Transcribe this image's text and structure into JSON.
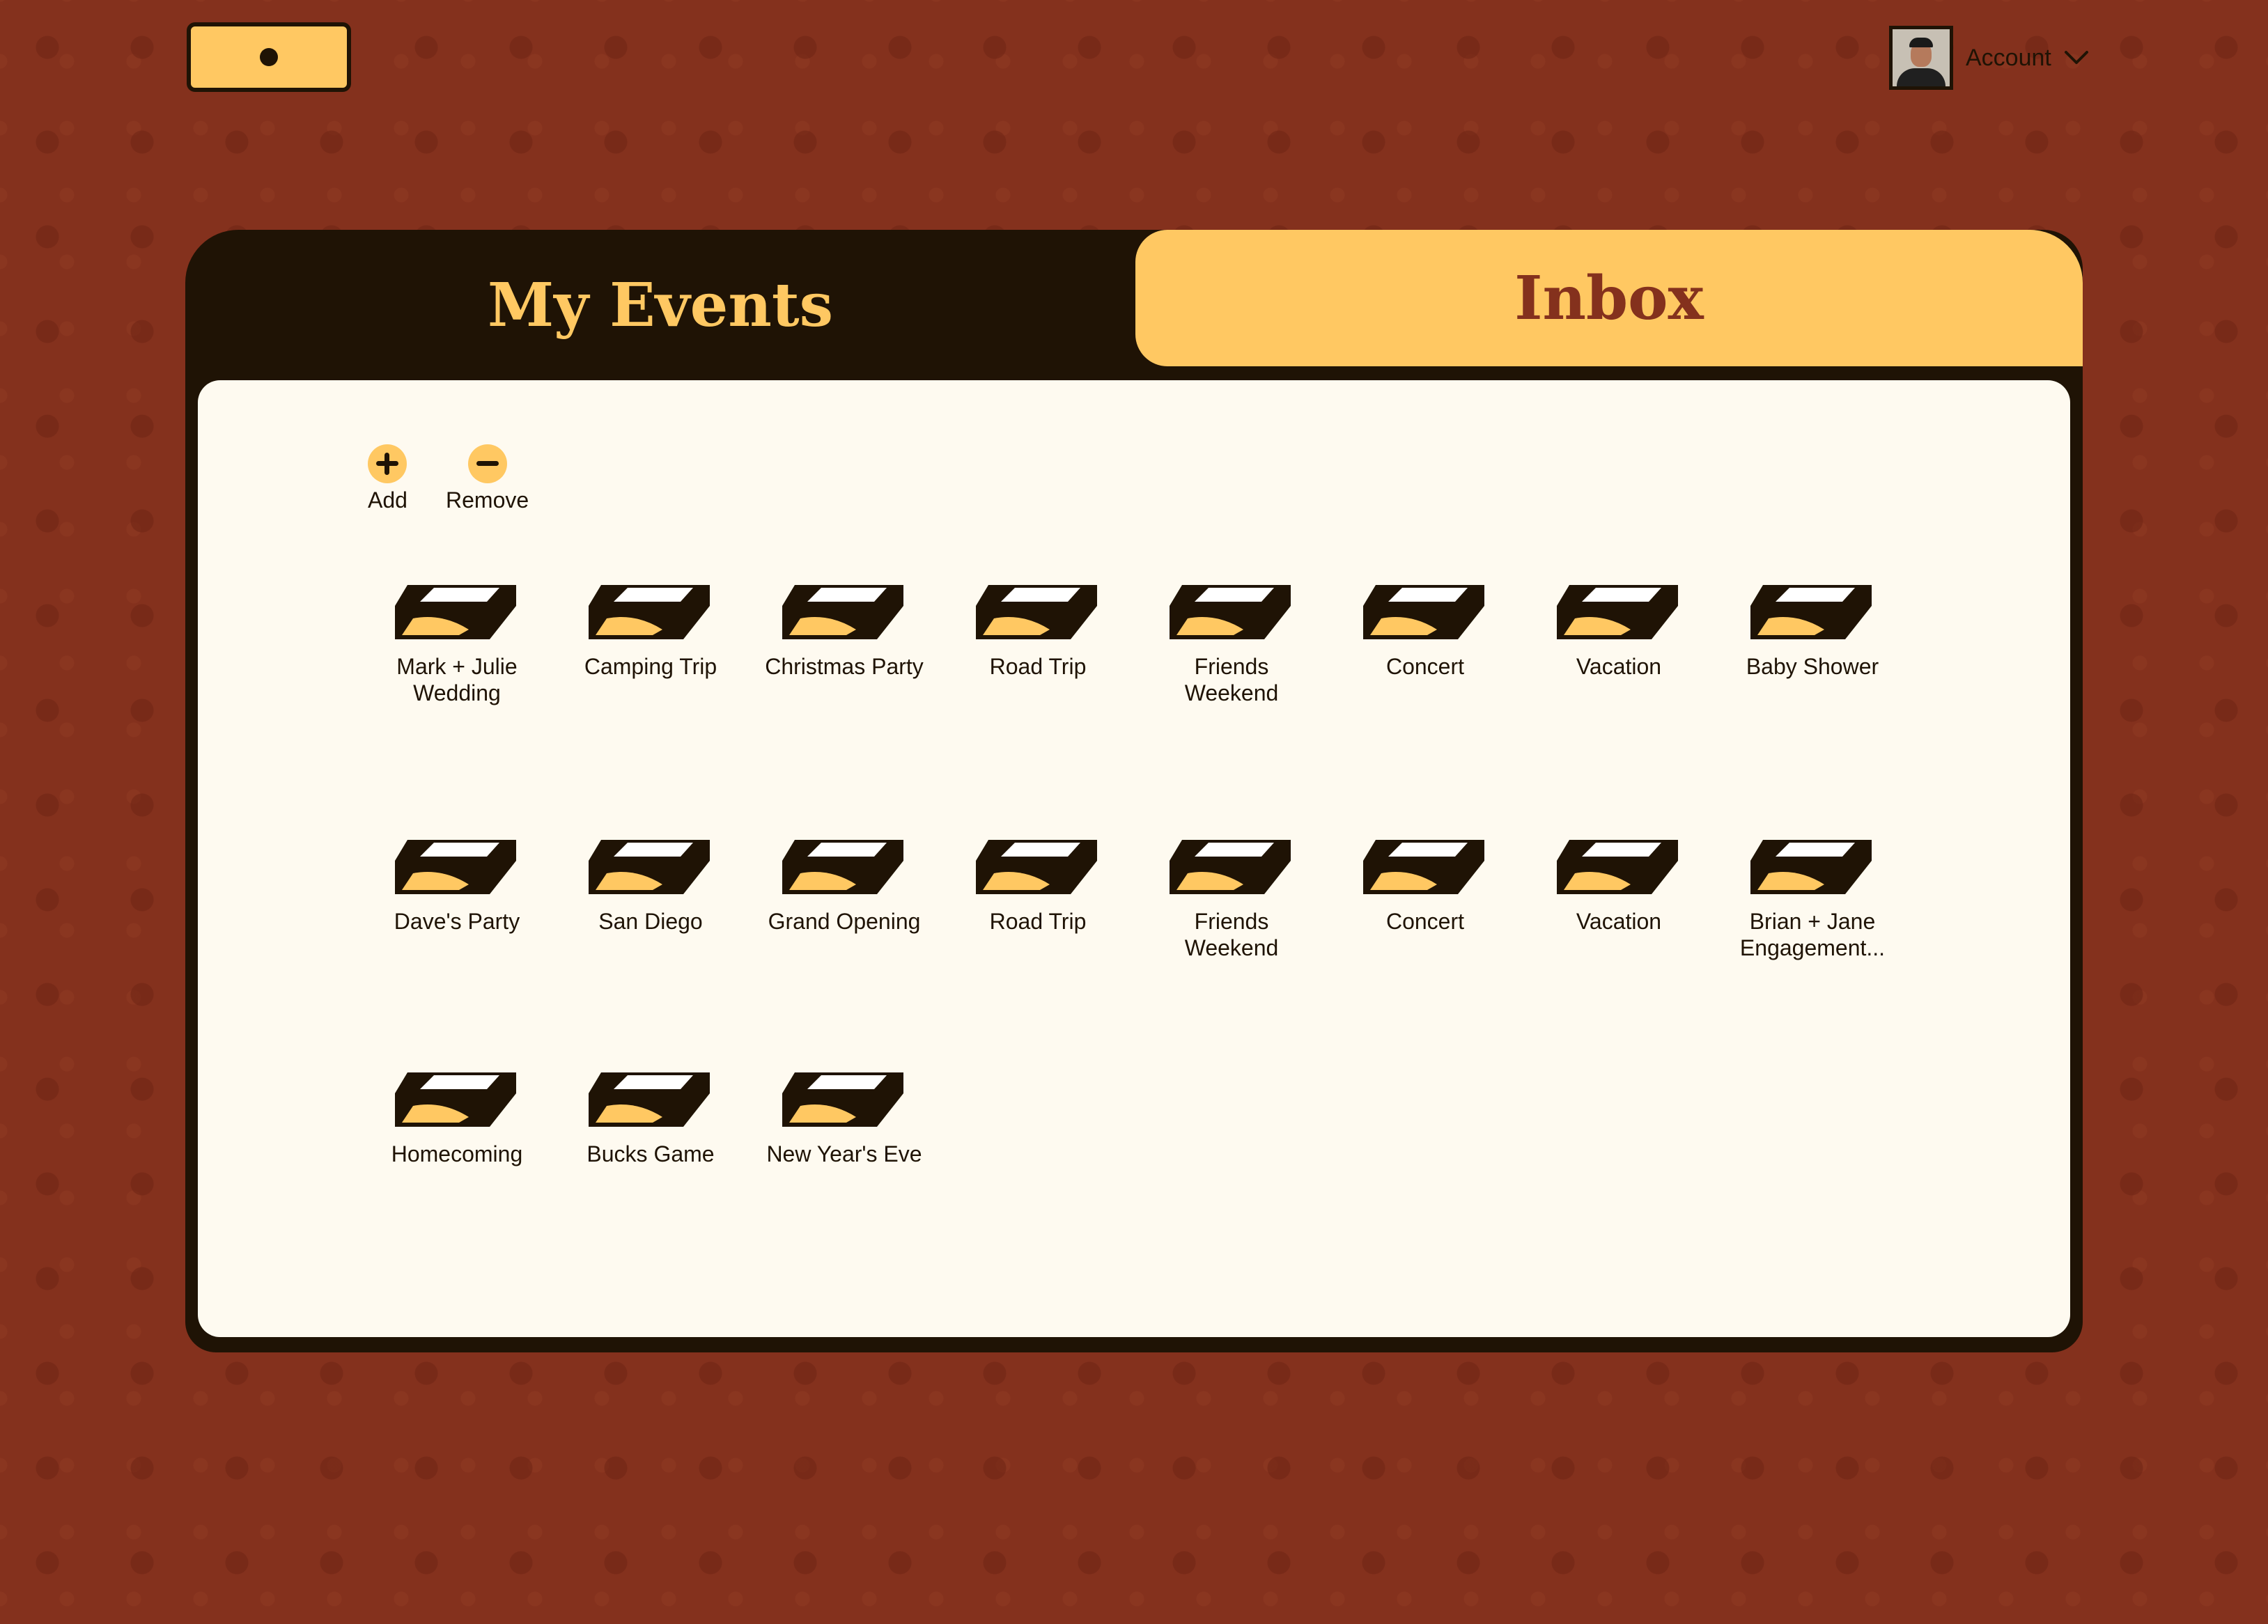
{
  "header": {
    "logo": "logo",
    "account_label": "Account",
    "account_icon": "chevron-down-icon",
    "avatar": "user-avatar"
  },
  "tabs": [
    {
      "label": "My Events",
      "active": true
    },
    {
      "label": "Inbox",
      "active": false
    }
  ],
  "toolbar": {
    "add_label": "Add",
    "add_icon": "plus-icon",
    "remove_label": "Remove",
    "remove_icon": "minus-icon"
  },
  "events": [
    {
      "label": "Mark + Julie\nWedding",
      "icon": "event-box-icon"
    },
    {
      "label": "Camping Trip",
      "icon": "event-box-icon"
    },
    {
      "label": "Christmas Party",
      "icon": "event-box-icon"
    },
    {
      "label": "Road Trip",
      "icon": "event-box-icon"
    },
    {
      "label": "Friends\nWeekend",
      "icon": "event-box-icon"
    },
    {
      "label": "Concert",
      "icon": "event-box-icon"
    },
    {
      "label": "Vacation",
      "icon": "event-box-icon"
    },
    {
      "label": "Baby Shower",
      "icon": "event-box-icon"
    },
    {
      "label": "Dave's Party",
      "icon": "event-box-icon"
    },
    {
      "label": "San Diego",
      "icon": "event-box-icon"
    },
    {
      "label": "Grand Opening",
      "icon": "event-box-icon"
    },
    {
      "label": "Road Trip",
      "icon": "event-box-icon"
    },
    {
      "label": "Friends\nWeekend",
      "icon": "event-box-icon"
    },
    {
      "label": "Concert",
      "icon": "event-box-icon"
    },
    {
      "label": "Vacation",
      "icon": "event-box-icon"
    },
    {
      "label": "Brian + Jane\nEngagement...",
      "icon": "event-box-icon"
    },
    {
      "label": "Homecoming",
      "icon": "event-box-icon"
    },
    {
      "label": "Bucks Game",
      "icon": "event-box-icon"
    },
    {
      "label": "New Year's Eve",
      "icon": "event-box-icon"
    }
  ],
  "colors": {
    "background": "#84311d",
    "dark": "#1f1305",
    "accent": "#ffc862",
    "content_bg": "#fefaf0",
    "inbox_text": "#84311d"
  }
}
